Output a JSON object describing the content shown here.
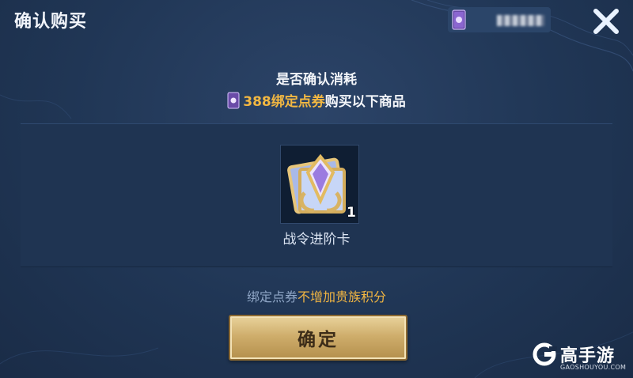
{
  "dialog": {
    "title": "确认购买",
    "close_icon": "close-icon"
  },
  "currency": {
    "icon": "bound-ticket-icon",
    "value_obscured": "00000"
  },
  "confirm": {
    "line1": "是否确认消耗",
    "amount_text": "388绑定点券",
    "line2_suffix": "购买以下商品"
  },
  "item": {
    "icon": "battle-pass-upgrade-card-icon",
    "count": "1",
    "name": "战令进阶卡"
  },
  "note": {
    "part1": "绑定点券",
    "part2": "不增加贵族积分"
  },
  "confirm_button": {
    "label": "确定"
  },
  "watermark": {
    "name": "高手游",
    "domain": "GAOSHOUYOU.COM"
  },
  "colors": {
    "accent_gold": "#f3b842",
    "background": "#203655",
    "button_gold": "#cfae6c"
  }
}
